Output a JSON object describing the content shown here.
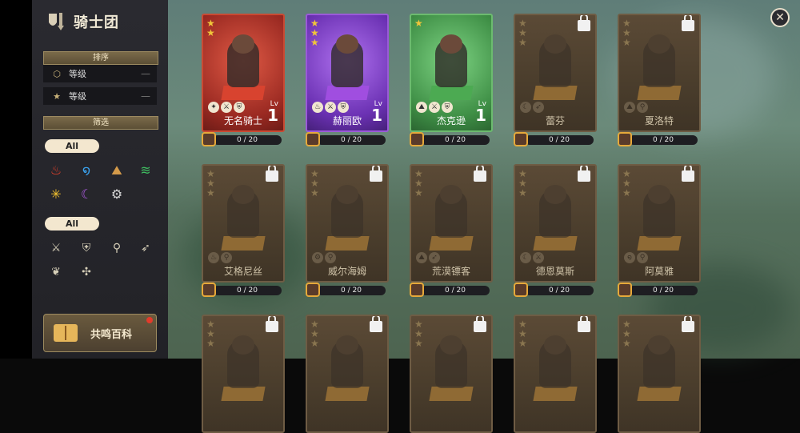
{
  "sidebar": {
    "title": "骑士团",
    "sort_header": "排序",
    "sort_rows": [
      {
        "icon": "shield-level-icon",
        "label": "等级",
        "control": "—"
      },
      {
        "icon": "star-icon",
        "label": "等级",
        "control": "—"
      }
    ],
    "filter_header": "筛选",
    "element_all": "All",
    "elements": [
      {
        "icon": "fire-icon",
        "glyph": "♨",
        "color": "#e8412c"
      },
      {
        "icon": "water-icon",
        "glyph": "໑",
        "color": "#3aa3f0"
      },
      {
        "icon": "earth-icon",
        "glyph": "⛰",
        "color": "#d49a4a"
      },
      {
        "icon": "wind-icon",
        "glyph": "≋",
        "color": "#3fbf62"
      },
      {
        "icon": "light-icon",
        "glyph": "✳",
        "color": "#f2c12e"
      },
      {
        "icon": "dark-icon",
        "glyph": "☾",
        "color": "#b25de8"
      },
      {
        "icon": "gear-icon",
        "glyph": "⚙",
        "color": "#d8d8d8"
      }
    ],
    "class_all": "All",
    "classes": [
      {
        "icon": "sword-icon",
        "glyph": "⚔"
      },
      {
        "icon": "shield-icon",
        "glyph": "⛨"
      },
      {
        "icon": "staff-icon",
        "glyph": "⚲"
      },
      {
        "icon": "bow-icon",
        "glyph": "➶"
      },
      {
        "icon": "feather-icon",
        "glyph": "❦"
      },
      {
        "icon": "support-icon",
        "glyph": "✣"
      }
    ],
    "encyclopedia_label": "共鸣百科"
  },
  "cards": [
    {
      "name": "无名骑士",
      "stars": 2,
      "locked": false,
      "theme": "red",
      "level_label": "Lv",
      "level": "1",
      "progress": "0 / 20",
      "badges": [
        "✦",
        "⚔",
        "⛨"
      ]
    },
    {
      "name": "赫丽欧",
      "stars": 3,
      "locked": false,
      "theme": "purple",
      "level_label": "Lv",
      "level": "1",
      "progress": "0 / 20",
      "badges": [
        "♨",
        "⚔",
        "⛨"
      ]
    },
    {
      "name": "杰克逊",
      "stars": 1,
      "locked": false,
      "theme": "green",
      "level_label": "Lv",
      "level": "1",
      "progress": "0 / 20",
      "badges": [
        "⛰",
        "⚔",
        "⛨"
      ]
    },
    {
      "name": "蕾芬",
      "stars": 3,
      "locked": true,
      "progress": "0 / 20",
      "badges": [
        "☾",
        "➶"
      ]
    },
    {
      "name": "夏洛特",
      "stars": 3,
      "locked": true,
      "progress": "0 / 20",
      "badges": [
        "⛰",
        "⚲"
      ]
    },
    {
      "name": "艾格尼丝",
      "stars": 3,
      "locked": true,
      "progress": "0 / 20",
      "badges": [
        "♨",
        "⚲"
      ]
    },
    {
      "name": "威尔海姆",
      "stars": 3,
      "locked": true,
      "progress": "0 / 20",
      "badges": [
        "⚙",
        "⚲"
      ]
    },
    {
      "name": "荒漠镖客",
      "stars": 3,
      "locked": true,
      "progress": "0 / 20",
      "badges": [
        "⛰",
        "➶"
      ]
    },
    {
      "name": "德恩莫斯",
      "stars": 3,
      "locked": true,
      "progress": "0 / 20",
      "badges": [
        "☾",
        "⚔"
      ]
    },
    {
      "name": "阿莫雅",
      "stars": 3,
      "locked": true,
      "progress": "0 / 20",
      "badges": [
        "໑",
        "⚲"
      ]
    },
    {
      "name": "",
      "stars": 3,
      "locked": true,
      "progress": "",
      "badges": []
    },
    {
      "name": "",
      "stars": 3,
      "locked": true,
      "progress": "",
      "badges": []
    },
    {
      "name": "",
      "stars": 3,
      "locked": true,
      "progress": "",
      "badges": []
    },
    {
      "name": "",
      "stars": 3,
      "locked": true,
      "progress": "",
      "badges": []
    },
    {
      "name": "",
      "stars": 3,
      "locked": true,
      "progress": "",
      "badges": []
    }
  ],
  "close_icon": "close-icon"
}
